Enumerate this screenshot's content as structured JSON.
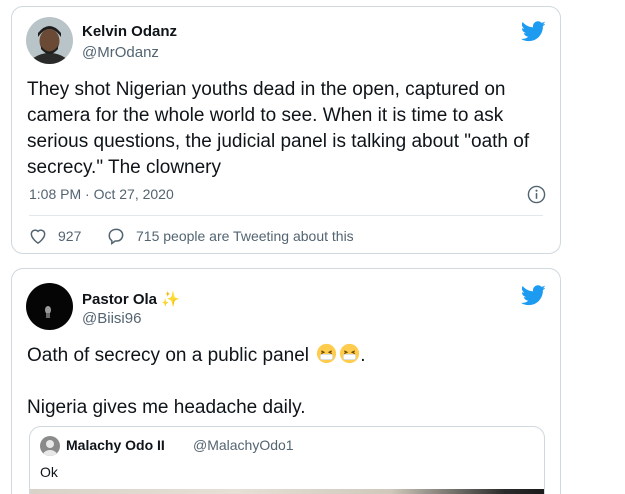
{
  "tweet1": {
    "author_name": "Kelvin Odanz",
    "author_handle": "@MrOdanz",
    "text_lines": [
      "They shot Nigerian youths dead in the open, captured on",
      "camera for the whole world to see. When it is time to ask",
      "serious questions, the judicial panel is talking about \"oath of",
      "secrecy.\" The clownery"
    ],
    "timestamp": "1:08 PM · Oct 27, 2020",
    "like_count": "927",
    "reply_summary": "715 people are Tweeting about this"
  },
  "tweet2": {
    "author_name": "Pastor Ola",
    "author_name_emoji": "✨",
    "author_handle": "@Biisi96",
    "text_line1": "Oath of secrecy on a public panel",
    "text_line1_suffix": ".",
    "text_line1_emojis": [
      "sneezing-face-emoji",
      "sneezing-face-emoji"
    ],
    "text_line2": "Nigeria gives me headache daily.",
    "quote": {
      "author_name": "Malachy Odo II",
      "author_handle": "@MalachyOdo1",
      "text": "Ok"
    }
  },
  "colors": {
    "twitter_blue": "#1d9bf0",
    "secondary_text": "#536471",
    "border": "#cfd9de"
  },
  "icons": [
    "twitter-bird-icon",
    "info-icon",
    "heart-icon",
    "reply-bubble-icon"
  ]
}
